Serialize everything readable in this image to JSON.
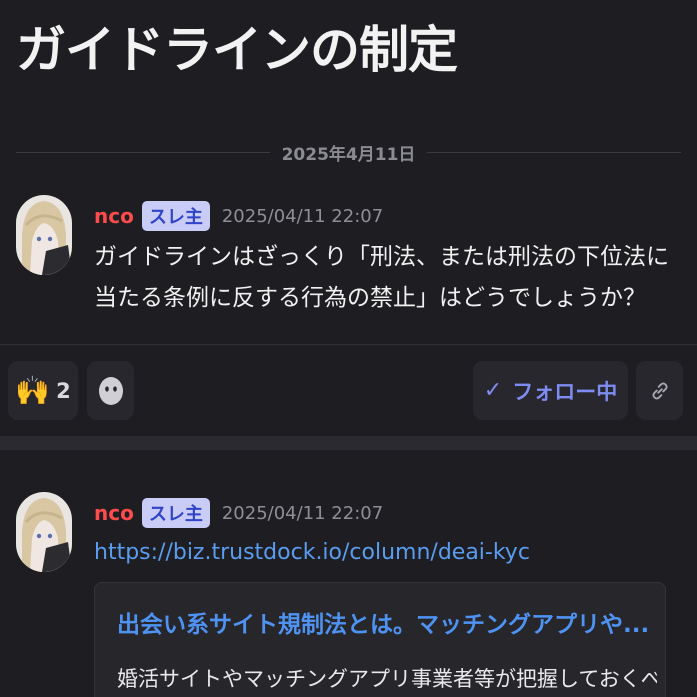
{
  "page": {
    "title": "ガイドラインの制定"
  },
  "date_divider": "2025年4月11日",
  "posts": [
    {
      "author": "nco",
      "badge": "スレ主",
      "time": "2025/04/11 22:07",
      "text_line1": "ガイドラインはざっくり「刑法、または刑法の下位法に",
      "text_line2": "当たる条例に反する行為の禁止」はどうでしょうか？"
    },
    {
      "author": "nco",
      "badge": "スレ主",
      "time": "2025/04/11 22:07",
      "link": "https://biz.trustdock.io/column/deai-kyc",
      "card_title": "出会い系サイト規制法とは。マッチングアプリや...",
      "card_desc": "婚活サイトやマッチングアプリ事業者等が把握しておくべき"
    }
  ],
  "reactions": {
    "raised_hands_count": "2",
    "raised_hands_emoji": "🙌",
    "follow_label": "フォロー中",
    "follow_check": "✓"
  },
  "colors": {
    "background": "#1e1e22",
    "author": "#ff4b4b",
    "badge_bg": "#c9ccf6",
    "link": "#5a9cf0",
    "follow": "#7f8cf2"
  }
}
